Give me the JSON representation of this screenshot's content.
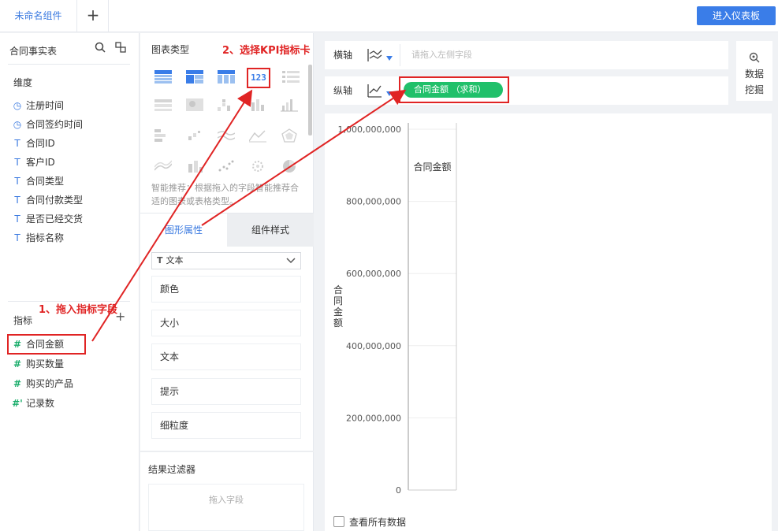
{
  "topbar": {
    "tab_label": "未命名组件",
    "add_tab": "+",
    "enter_dashboard": "进入仪表板"
  },
  "left": {
    "title": "合同事实表",
    "dimensions_title": "维度",
    "dimensions": [
      {
        "icon": "clock-icon",
        "label": "注册时间"
      },
      {
        "icon": "clock-icon",
        "label": "合同签约时间"
      },
      {
        "icon": "text-type-icon",
        "label": "合同ID"
      },
      {
        "icon": "text-type-icon",
        "label": "客户ID"
      },
      {
        "icon": "text-type-icon",
        "label": "合同类型"
      },
      {
        "icon": "text-type-icon",
        "label": "合同付款类型"
      },
      {
        "icon": "text-type-icon",
        "label": "是否已经交货"
      },
      {
        "icon": "text-type-icon",
        "label": "指标名称"
      }
    ],
    "metrics_title": "指标",
    "metrics_plus": "+",
    "metrics": [
      {
        "icon": "#",
        "label": "合同金额"
      },
      {
        "icon": "#",
        "label": "购买数量"
      },
      {
        "icon": "#",
        "label": "购买的产品"
      },
      {
        "icon": "#'",
        "label": "记录数"
      }
    ],
    "annotation": "1、拖入指标字段"
  },
  "middle": {
    "chart_type_title": "图表类型",
    "annotation": "2、选择KPI指标卡",
    "kpi_label": "123",
    "smart_text": "智能推荐：根据拖入的字段智能推荐合适的图表或表格类型。",
    "tab_graphic": "图形属性",
    "tab_style": "组件样式",
    "select_value": "文本",
    "props": [
      "颜色",
      "大小",
      "文本",
      "提示",
      "细粒度"
    ],
    "filter_title": "结果过滤器",
    "filter_placeholder": "拖入字段"
  },
  "right": {
    "x_axis_label": "横轴",
    "x_axis_placeholder": "请拖入左侧字段",
    "y_axis_label": "纵轴",
    "y_pill": "合同金额  （求和）",
    "mining_line1": "数据",
    "mining_line2": "挖掘",
    "checkbox_label": "查看所有数据"
  },
  "chart_data": {
    "type": "bar",
    "categories": [
      "合同金额"
    ],
    "values": [
      0
    ],
    "ylabel": "合同金额",
    "ylim": [
      0,
      1000000000
    ],
    "yticks": [
      0,
      200000000,
      400000000,
      600000000,
      800000000,
      1000000000
    ],
    "ytick_labels": [
      "0",
      "200,000,000",
      "400,000,000",
      "600,000,000",
      "800,000,000",
      "1,000,000,000"
    ],
    "grid": true
  },
  "colors": {
    "accent": "#3a7de8",
    "highlight": "#e02424",
    "pill": "#20c06a"
  }
}
